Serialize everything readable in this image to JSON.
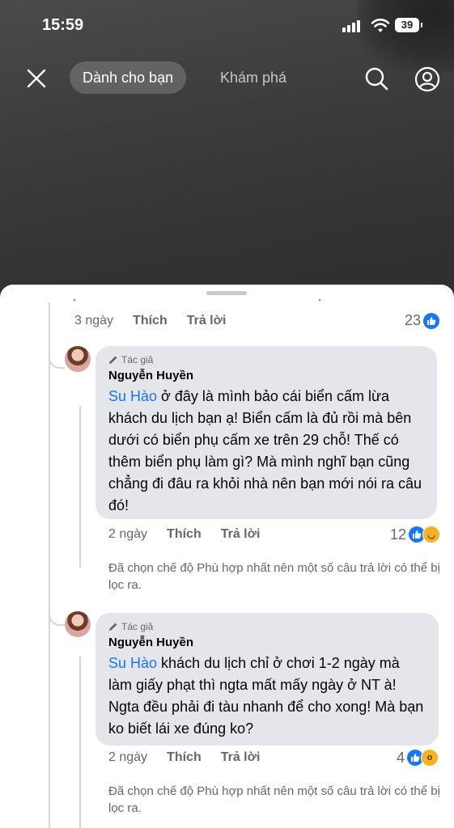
{
  "status_bar": {
    "time": "15:59",
    "battery": "39"
  },
  "nav": {
    "tab_active": "Dành cho bạn",
    "tab_other": "Khám phá"
  },
  "comments": {
    "parent_actions": {
      "time": "3 ngày",
      "like": "Thích",
      "reply": "Trả lời",
      "count": "23"
    },
    "reply1": {
      "author_tag": "Tác giả",
      "author": "Nguyễn Huyền",
      "mention": "Su Hào",
      "text": " ở đây là mình bảo cái biển cấm lừa khách du lịch bạn ạ! Biển cấm là đủ rồi mà bên dưới có biển phụ cấm xe trên 29 chỗ! Thế có thêm biển phụ làm gì? Mà mình nghĩ bạn cũng chẳng đi đâu ra khỏi nhà nên bạn mới nói ra câu đó!",
      "time": "2 ngày",
      "like": "Thích",
      "reply": "Trả lời",
      "count": "12"
    },
    "filter_note1": "Đã chọn chế độ Phù hợp nhất nên một số câu trả lời có thể bị lọc ra.",
    "reply2": {
      "author_tag": "Tác giả",
      "author": "Nguyễn Huyền",
      "mention": "Su Hào",
      "text": " khách du lịch chỉ ở chơi 1-2 ngày mà làm giấy phạt thì ngta mất mấy ngày ở NT à! Ngta đều phải đi tàu nhanh để  cho xong! Mà bạn ko biết lái xe đúng ko?",
      "time": "2 ngày",
      "like": "Thích",
      "reply": "Trả lời",
      "count": "4"
    },
    "filter_note2": "Đã chọn chế độ Phù hợp nhất nên một số câu trả lời có thể bị lọc ra."
  },
  "colors": {
    "accent": "#1877f2",
    "bubble": "#e4e6eb",
    "muted": "#65676b"
  },
  "icons": [
    "close-icon",
    "search-icon",
    "profile-icon",
    "pencil-icon",
    "like-icon",
    "haha-icon",
    "wow-icon"
  ]
}
